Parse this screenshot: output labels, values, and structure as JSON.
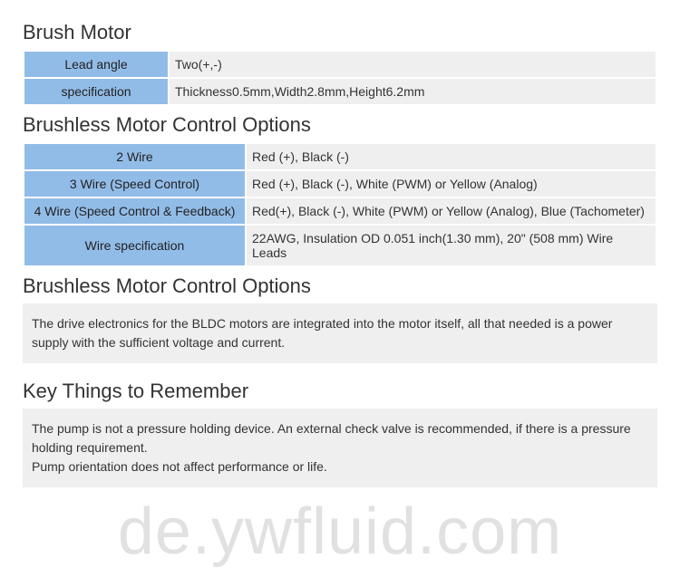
{
  "sections": {
    "brush_motor": {
      "title": "Brush Motor",
      "rows": [
        {
          "label": "Lead angle",
          "value": "Two(+,-)"
        },
        {
          "label": "specification",
          "value": "Thickness0.5mm,Width2.8mm,Height6.2mm"
        }
      ]
    },
    "brushless_options_table": {
      "title": "Brushless Motor Control Options",
      "rows": [
        {
          "label": "2 Wire",
          "value": "Red (+), Black (-)"
        },
        {
          "label": "3 Wire (Speed Control)",
          "value": "Red (+), Black (-), White (PWM) or Yellow (Analog)"
        },
        {
          "label": "4 Wire (Speed Control & Feedback)",
          "value": "Red(+), Black (-), White (PWM) or Yellow (Analog), Blue (Tachometer)"
        },
        {
          "label": "Wire specification",
          "value": "22AWG, Insulation OD 0.051 inch(1.30 mm), 20\" (508 mm) Wire Leads"
        }
      ]
    },
    "brushless_options_text": {
      "title": "Brushless Motor Control Options",
      "body": "The drive electronics for the BLDC motors are integrated into the motor itself, all that needed is a power supply with the sufficient voltage and current."
    },
    "key_things": {
      "title": "Key Things to Remember",
      "body1": "The pump is not a pressure holding device. An external check valve is recommended, if there is a pressure holding requirement.",
      "body2": "Pump orientation does not affect performance or life."
    }
  },
  "watermark": "de.ywfluid.com"
}
